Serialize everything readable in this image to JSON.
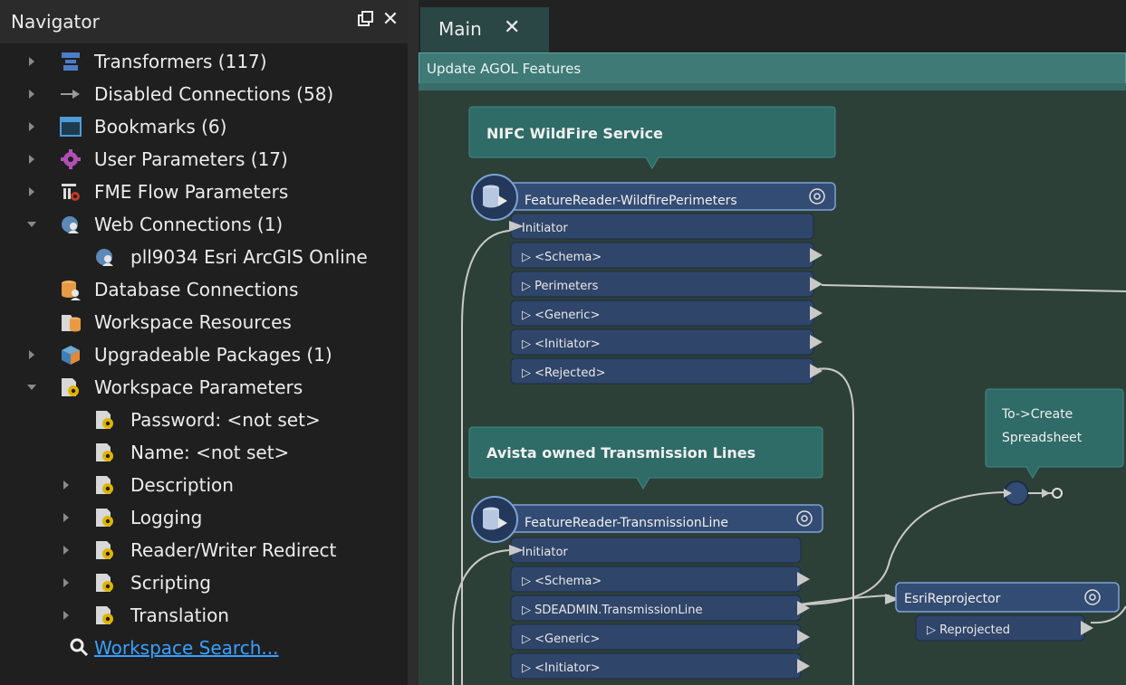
{
  "navigator": {
    "title": "Navigator",
    "items": [
      {
        "label": "Transformers (117)",
        "arrow": "right"
      },
      {
        "label": "Disabled Connections (58)",
        "arrow": "right"
      },
      {
        "label": "Bookmarks (6)",
        "arrow": "right"
      },
      {
        "label": "User Parameters (17)",
        "arrow": "right"
      },
      {
        "label": "FME Flow Parameters",
        "arrow": "right"
      },
      {
        "label": "Web Connections (1)",
        "arrow": "down"
      },
      {
        "label": "pll9034 Esri ArcGIS Online",
        "arrow": ""
      },
      {
        "label": "Database Connections",
        "arrow": ""
      },
      {
        "label": "Workspace Resources",
        "arrow": ""
      },
      {
        "label": "Upgradeable Packages (1)",
        "arrow": "right"
      },
      {
        "label": "Workspace Parameters",
        "arrow": "down"
      },
      {
        "label": "Password: <not set>",
        "arrow": ""
      },
      {
        "label": "Name: <not set>",
        "arrow": ""
      },
      {
        "label": "Description",
        "arrow": "right"
      },
      {
        "label": "Logging",
        "arrow": "right"
      },
      {
        "label": "Reader/Writer Redirect",
        "arrow": "right"
      },
      {
        "label": "Scripting",
        "arrow": "right"
      },
      {
        "label": "Translation",
        "arrow": "right"
      }
    ],
    "search_link": "Workspace Search..."
  },
  "tab": {
    "label": "Main",
    "close": "✕"
  },
  "canvas": {
    "bookmark_title": "Update AGOL Features",
    "annotation1": "NIFC WildFire Service",
    "annotation2": "Avista owned Transmission Lines",
    "junction_note_line1": "To->Create",
    "junction_note_line2": "Spreadsheet",
    "reader1": {
      "name": "FeatureReader-WildfirePerimeters",
      "input": "Initiator",
      "ports": [
        "<Schema>",
        "Perimeters",
        "<Generic>",
        "<Initiator>",
        "<Rejected>"
      ]
    },
    "reader2": {
      "name": "FeatureReader-TransmissionLine",
      "input": "Initiator",
      "ports": [
        "<Schema>",
        "SDEADMIN.TransmissionLine",
        "<Generic>",
        "<Initiator>"
      ]
    },
    "reprojector": {
      "name": "EsriReprojector",
      "ports": [
        "Reprojected"
      ]
    }
  },
  "colors": {
    "annotation_fill": "#2f6b67",
    "transformer_fill": "#334c73",
    "port_fill": "#2f4569",
    "connection": "#c9c9c9",
    "canvas_bg": "#2d4038"
  }
}
